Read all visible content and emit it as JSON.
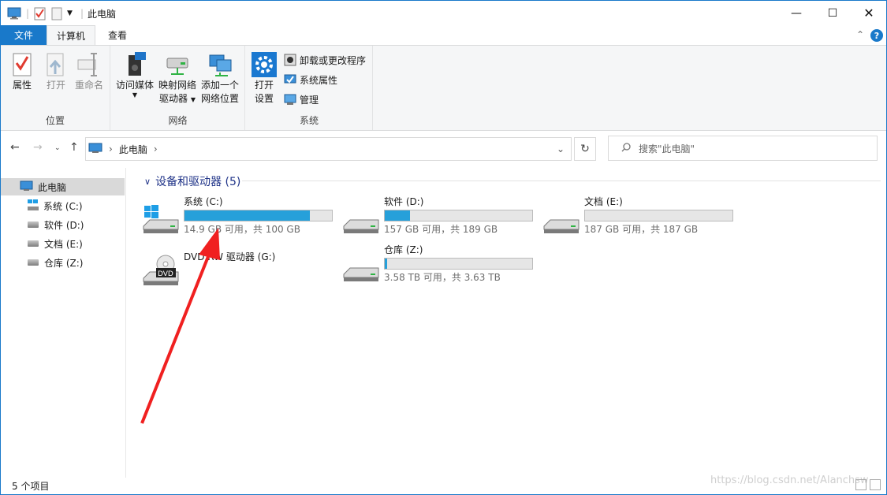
{
  "window": {
    "title": "此电脑"
  },
  "tabs": {
    "file": "文件",
    "computer": "计算机",
    "view": "查看"
  },
  "ribbon": {
    "location": {
      "label": "位置",
      "properties": "属性",
      "open": "打开",
      "rename": "重命名"
    },
    "network": {
      "label": "网络",
      "media_line1": "访问媒体",
      "map_line1": "映射网络",
      "map_line2": "驱动器",
      "add_line1": "添加一个",
      "add_line2": "网络位置"
    },
    "system": {
      "label": "系统",
      "settings_line1": "打开",
      "settings_line2": "设置",
      "uninstall": "卸载或更改程序",
      "sysprops": "系统属性",
      "manage": "管理"
    }
  },
  "address": {
    "crumb": "此电脑",
    "search_placeholder": "搜索\"此电脑\""
  },
  "navpane": {
    "items": [
      {
        "label": "此电脑"
      },
      {
        "label": "系统 (C:)"
      },
      {
        "label": "软件 (D:)"
      },
      {
        "label": "文档 (E:)"
      },
      {
        "label": "仓库 (Z:)"
      }
    ]
  },
  "content": {
    "section_title": "设备和驱动器 (5)",
    "drives": [
      {
        "name": "系统 (C:)",
        "free_text": "14.9 GB 可用，共 100 GB",
        "used_fraction": 0.851
      },
      {
        "name": "软件 (D:)",
        "free_text": "157 GB 可用，共 189 GB",
        "used_fraction": 0.169
      },
      {
        "name": "文档 (E:)",
        "free_text": "187 GB 可用，共 187 GB",
        "used_fraction": 0.0
      },
      {
        "name": "DVD RW 驱动器 (G:)"
      },
      {
        "name": "仓库 (Z:)",
        "free_text": "3.58 TB 可用，共 3.63 TB",
        "used_fraction": 0.014
      }
    ]
  },
  "status": {
    "count": "5 个项目"
  },
  "watermark": "https://blog.csdn.net/Alanchsw"
}
